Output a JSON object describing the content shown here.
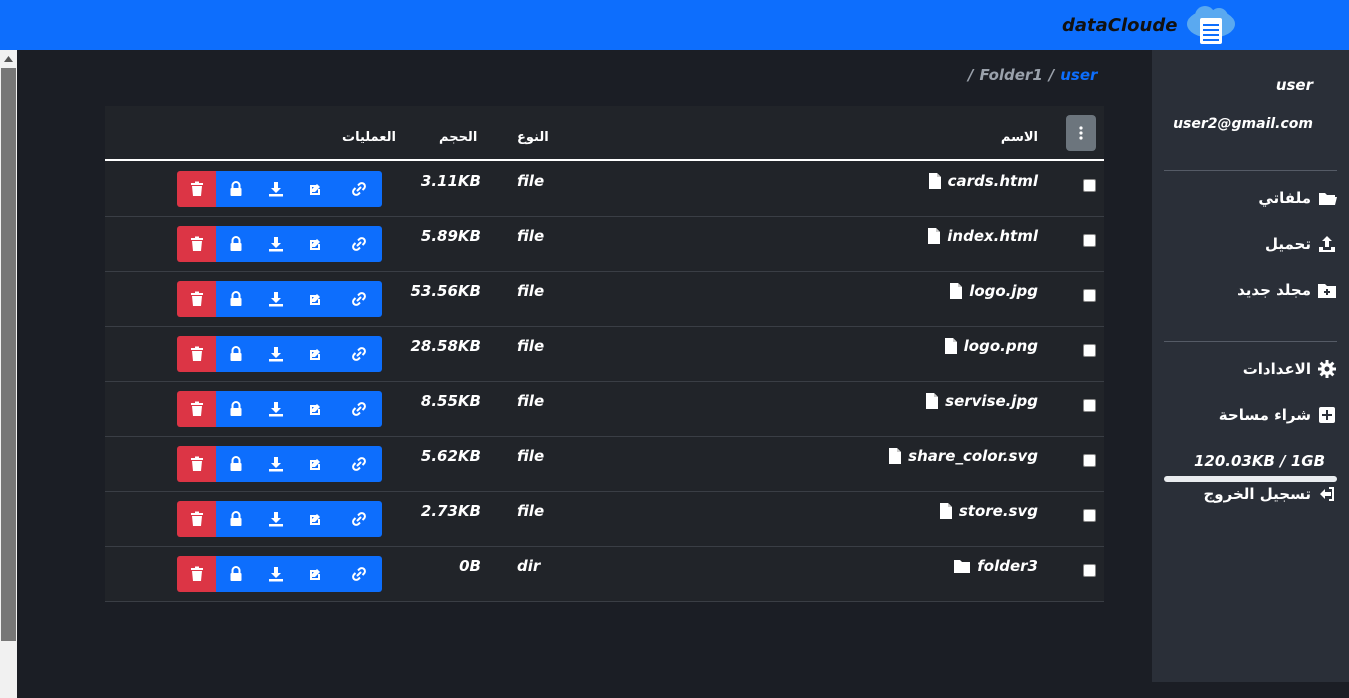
{
  "brand": {
    "name": "dataCloude"
  },
  "sidebar": {
    "user": "user",
    "email": "user2@gmail.com",
    "items": [
      {
        "label": "ملفاتي",
        "icon": "folder-open-icon"
      },
      {
        "label": "تحميل",
        "icon": "upload-icon"
      },
      {
        "label": "مجلد جديد",
        "icon": "folder-plus-icon"
      },
      {
        "label": "الاعدادات",
        "icon": "gear-icon"
      },
      {
        "label": "شراء مساحة",
        "icon": "plus-square-icon"
      },
      {
        "label": "تسجيل الخروج",
        "icon": "logout-icon"
      }
    ],
    "quota": "120.03KB / 1GB",
    "quota_fraction": 0.0001
  },
  "breadcrumb": [
    {
      "label": "/"
    },
    {
      "label": "Folder1"
    },
    {
      "label": "/"
    },
    {
      "label": "user"
    }
  ],
  "table": {
    "headers": {
      "name": "الاسم",
      "type": "النوع",
      "size": "الحجم",
      "ops": "العمليات"
    },
    "rows": [
      {
        "name": "cards.html",
        "type": "file",
        "size": "3.11KB",
        "icon": "file-icon"
      },
      {
        "name": "index.html",
        "type": "file",
        "size": "5.89KB",
        "icon": "file-icon"
      },
      {
        "name": "logo.jpg",
        "type": "file",
        "size": "53.56KB",
        "icon": "file-icon"
      },
      {
        "name": "logo.png",
        "type": "file",
        "size": "28.58KB",
        "icon": "file-icon"
      },
      {
        "name": "servise.jpg",
        "type": "file",
        "size": "8.55KB",
        "icon": "file-icon"
      },
      {
        "name": "share_color.svg",
        "type": "file",
        "size": "5.62KB",
        "icon": "file-icon"
      },
      {
        "name": "store.svg",
        "type": "file",
        "size": "2.73KB",
        "icon": "file-icon"
      },
      {
        "name": "folder3",
        "type": "dir",
        "size": "0B",
        "icon": "folder-icon"
      }
    ]
  },
  "colors": {
    "primary": "#0d6efd",
    "danger": "#dc3545",
    "bg": "#1b1e25",
    "sidebar": "#2a2f38",
    "table": "#212429"
  }
}
